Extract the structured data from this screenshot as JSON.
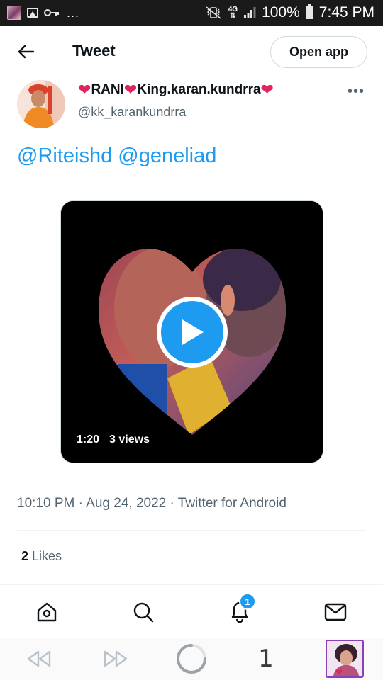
{
  "status_bar": {
    "time": "7:45 PM",
    "battery": "100%",
    "network": "4G",
    "more_notifications": "..."
  },
  "header": {
    "title": "Tweet",
    "open_app_label": "Open app"
  },
  "tweet": {
    "author": {
      "display_name_parts": [
        "RANI",
        "King.karan.kundrra"
      ],
      "handle": "@kk_karankundrra"
    },
    "mentions": [
      "@Riteishd",
      "@geneliad"
    ],
    "video": {
      "duration": "1:20",
      "views": "3 views"
    },
    "time": "10:10 PM",
    "date": "Aug 24, 2022",
    "source": "Twitter for Android",
    "separator": "·",
    "likes_count": "2",
    "likes_label": "Likes"
  },
  "bottom_nav": {
    "notification_badge": "1",
    "items": [
      "home",
      "search",
      "notifications",
      "messages"
    ]
  },
  "browser_toolbar": {
    "tab_count": "1"
  },
  "colors": {
    "accent": "#1d9bf0",
    "text_primary": "#0f1419",
    "text_secondary": "#536471",
    "heart": "#e0245e"
  }
}
